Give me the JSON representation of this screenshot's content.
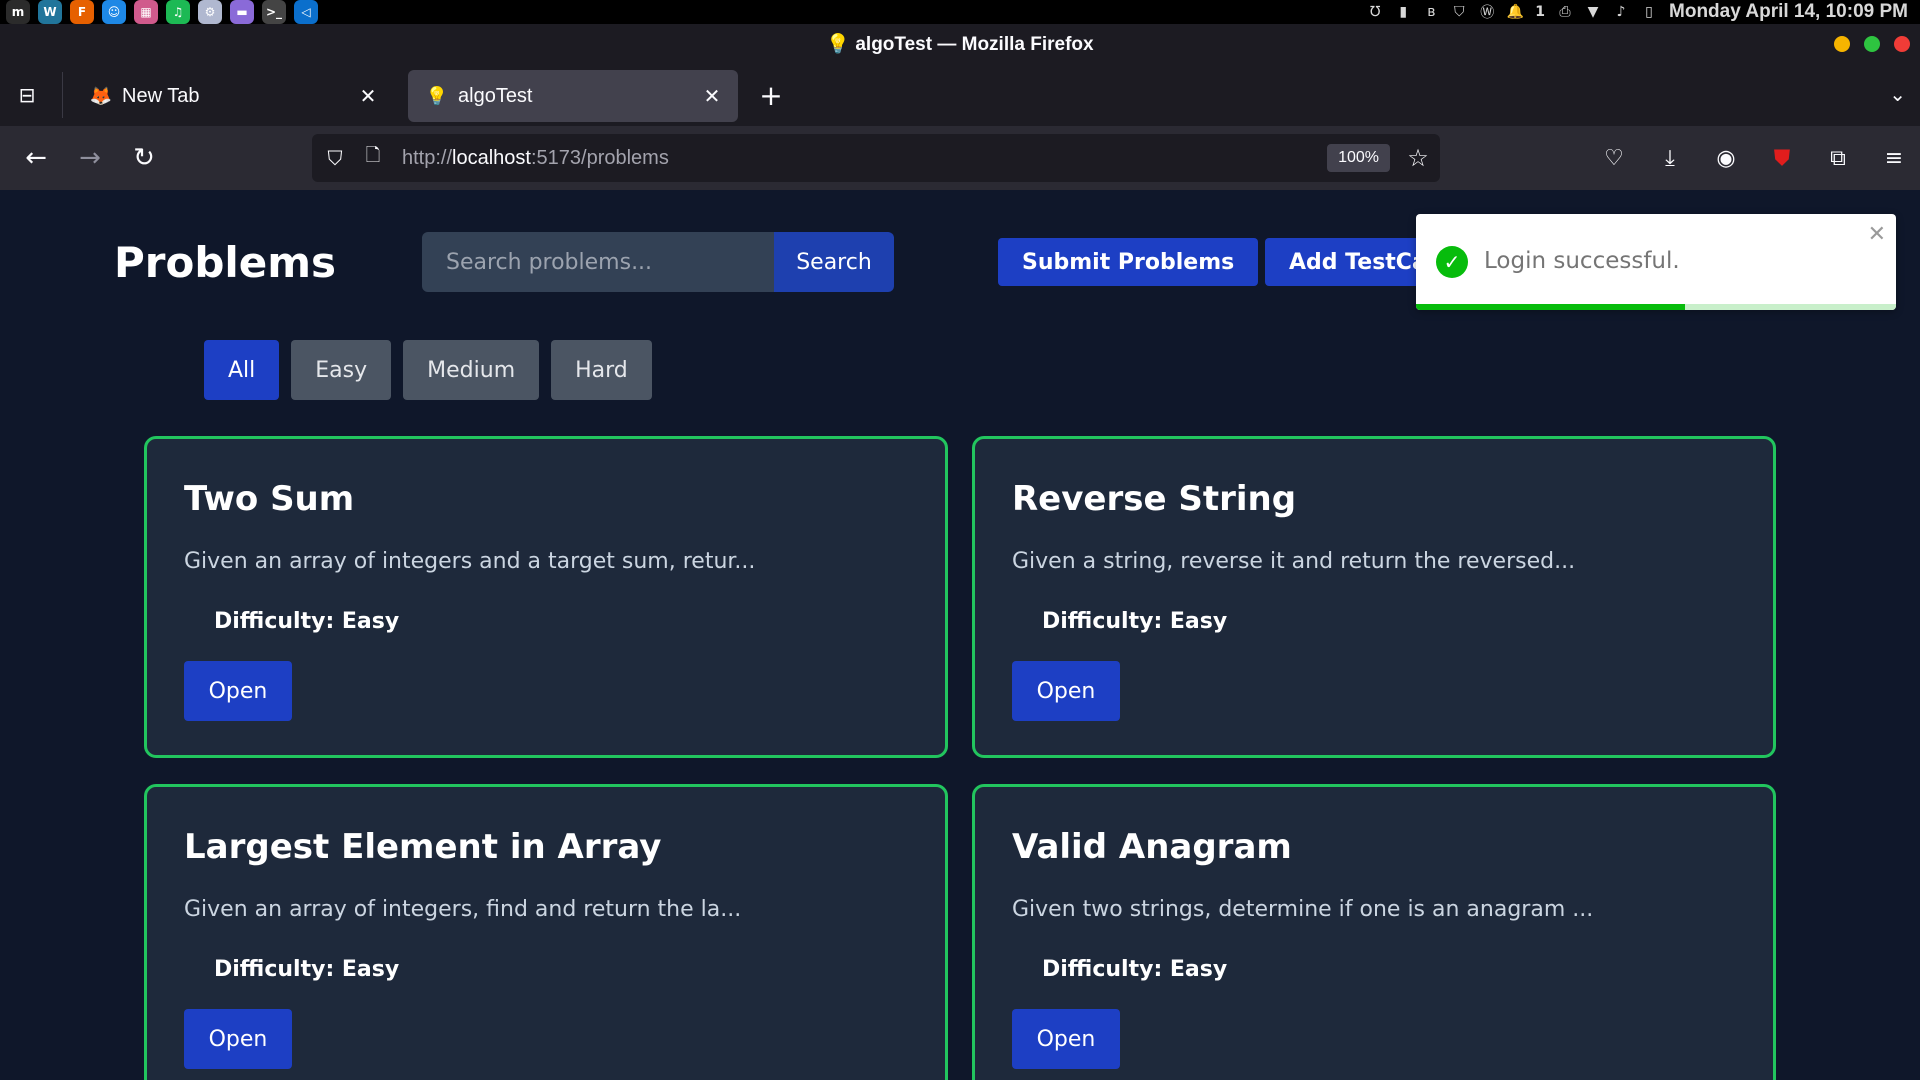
{
  "os": {
    "clock": "Monday April 14, 10:09 PM",
    "workspace_indicator": "1",
    "apps": [
      {
        "name": "mint-menu-icon",
        "glyph": "m",
        "color": "#2b2b2b"
      },
      {
        "name": "wordpress-icon",
        "glyph": "W",
        "color": "#21759b"
      },
      {
        "name": "firefox-icon",
        "glyph": "F",
        "color": "#e66000"
      },
      {
        "name": "finder-icon",
        "glyph": "☺",
        "color": "#1e88e5"
      },
      {
        "name": "calendar-icon",
        "glyph": "▦",
        "color": "#d05a8c"
      },
      {
        "name": "spotify-icon",
        "glyph": "♫",
        "color": "#1db954"
      },
      {
        "name": "settings-icon",
        "glyph": "⚙",
        "color": "#b0b8d0"
      },
      {
        "name": "folder-icon",
        "glyph": "▬",
        "color": "#8a6ad8"
      },
      {
        "name": "terminal-icon",
        "glyph": ">_",
        "color": "#444"
      },
      {
        "name": "vscode-icon",
        "glyph": "◁",
        "color": "#0b6fcc"
      }
    ]
  },
  "browser": {
    "window_title": "💡 algoTest — Mozilla Firefox",
    "tabs": [
      {
        "label": "New Tab",
        "favicon": "🦊",
        "active": false
      },
      {
        "label": "algoTest",
        "favicon": "💡",
        "active": true
      }
    ],
    "url_prefix": "http://",
    "url_host": "localhost",
    "url_path": ":5173/problems",
    "zoom": "100%"
  },
  "page": {
    "title": "Problems",
    "search_placeholder": "Search problems...",
    "search_button": "Search",
    "submit_button": "Submit Problems",
    "add_testcase_button": "Add TestCases",
    "filters": [
      {
        "label": "All",
        "active": true
      },
      {
        "label": "Easy",
        "active": false
      },
      {
        "label": "Medium",
        "active": false
      },
      {
        "label": "Hard",
        "active": false
      }
    ],
    "problems": [
      {
        "title": "Two Sum",
        "description": "Given an array of integers and a target sum, retur...",
        "difficulty": "Difficulty: Easy",
        "open": "Open"
      },
      {
        "title": "Reverse String",
        "description": "Given a string, reverse it and return the reversed...",
        "difficulty": "Difficulty: Easy",
        "open": "Open"
      },
      {
        "title": "Largest Element in Array",
        "description": "Given an array of integers, find and return the la...",
        "difficulty": "Difficulty: Easy",
        "open": "Open"
      },
      {
        "title": "Valid Anagram",
        "description": "Given two strings, determine if one is an anagram ...",
        "difficulty": "Difficulty: Easy",
        "open": "Open"
      }
    ]
  },
  "toast": {
    "message": "Login successful.",
    "progress": 0.56,
    "color": "#07bc0c"
  },
  "colors": {
    "page_bg": "#0f172a",
    "card_bg": "#1e293b",
    "card_border": "#22c55e",
    "primary": "#1d3fc4"
  }
}
